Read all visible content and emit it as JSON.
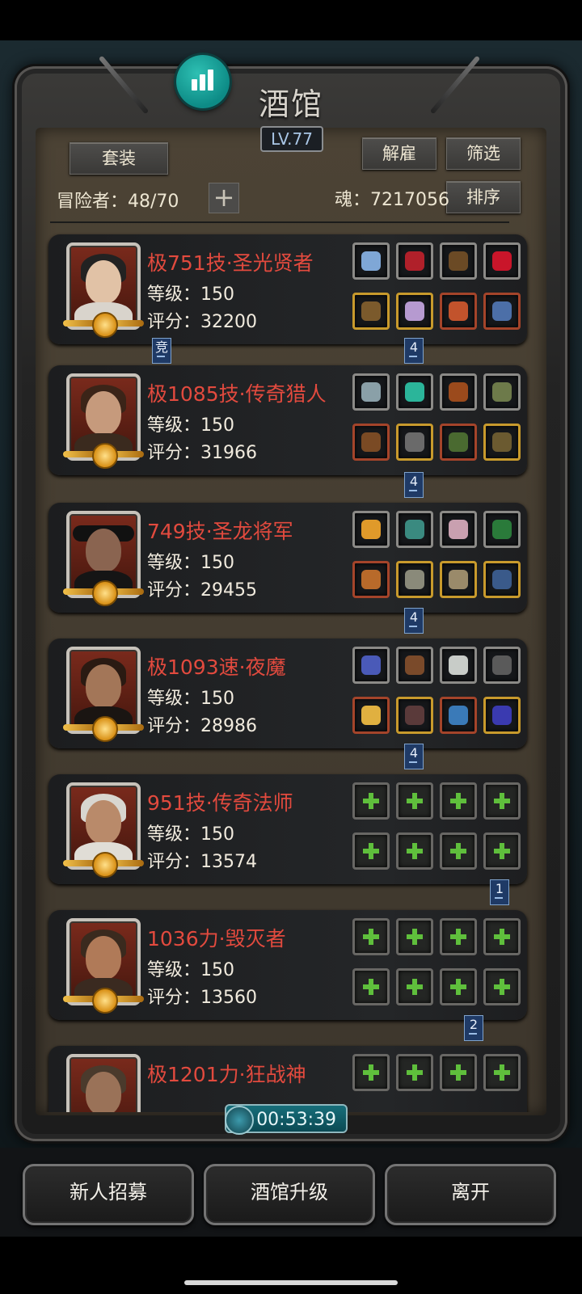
{
  "header": {
    "title": "酒馆",
    "level": "LV.77"
  },
  "toolbar": {
    "set_label": "套装",
    "dismiss_label": "解雇",
    "filter_label": "筛选",
    "sort_label": "排序",
    "adventurers_label": "冒险者：48/70",
    "soul_label": "魂：7217056",
    "add_label": "+"
  },
  "heroes": [
    {
      "name": "极751技·圣光贤者",
      "level": "等级：150",
      "score": "评分：32200"
    },
    {
      "name": "极1085技·传奇猎人",
      "level": "等级：150",
      "score": "评分：31966"
    },
    {
      "name": "749技·圣龙将军",
      "level": "等级：150",
      "score": "评分：29455"
    },
    {
      "name": "极1093速·夜魔",
      "level": "等级：150",
      "score": "评分：28986"
    },
    {
      "name": "951技·传奇法师",
      "level": "等级：150",
      "score": "评分：13574"
    },
    {
      "name": "1036力·毁灭者",
      "level": "等级：150",
      "score": "评分：13560"
    },
    {
      "name": "极1201力·狂战神",
      "level": "",
      "score": ""
    }
  ],
  "connectors": {
    "c1_left": "竞",
    "c1_right": "4",
    "c2": "4",
    "c3": "4",
    "c4": "4",
    "c5": "1",
    "c6": "2"
  },
  "timer": "00:53:39",
  "bottom": {
    "recruit_label": "新人招募",
    "upgrade_label": "酒馆升级",
    "leave_label": "离开"
  },
  "colors": {
    "hero_name": "#e24a3e",
    "accent_teal": "#0d8b86",
    "connector_blue": "#1f3a66"
  }
}
